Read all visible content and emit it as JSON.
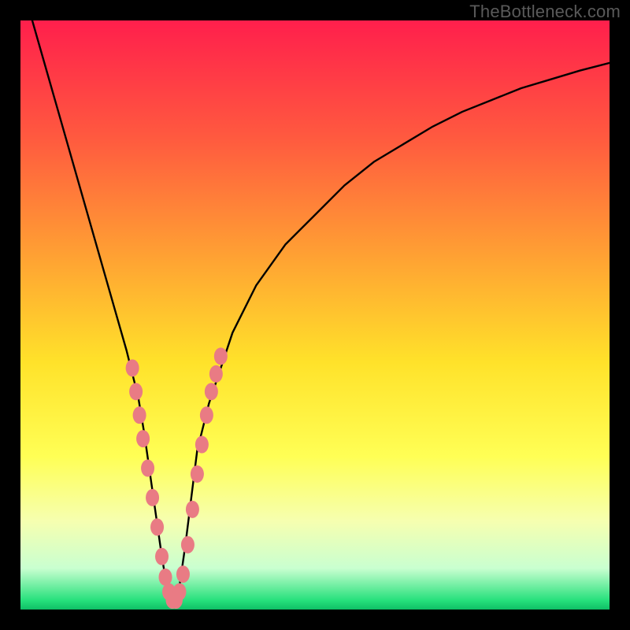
{
  "watermark": "TheBottleneck.com",
  "chart_data": {
    "type": "line",
    "title": "",
    "xlabel": "",
    "ylabel": "",
    "xlim": [
      0,
      100
    ],
    "ylim": [
      0,
      100
    ],
    "grid": false,
    "legend": false,
    "background_gradient_stops": [
      {
        "offset": 0.0,
        "color": "#ff1f4c"
      },
      {
        "offset": 0.2,
        "color": "#ff5a3f"
      },
      {
        "offset": 0.4,
        "color": "#ffa133"
      },
      {
        "offset": 0.58,
        "color": "#ffe22a"
      },
      {
        "offset": 0.74,
        "color": "#ffff55"
      },
      {
        "offset": 0.85,
        "color": "#f6ffb0"
      },
      {
        "offset": 0.93,
        "color": "#c9ffd0"
      },
      {
        "offset": 0.985,
        "color": "#25e07b"
      },
      {
        "offset": 1.0,
        "color": "#0fbf66"
      }
    ],
    "series": [
      {
        "name": "bottleneck-curve",
        "x": [
          2,
          4,
          6,
          8,
          10,
          12,
          14,
          16,
          18,
          20,
          21,
          22,
          23,
          24,
          25,
          26,
          27,
          28,
          29,
          30,
          32,
          34,
          36,
          40,
          45,
          50,
          55,
          60,
          65,
          70,
          75,
          80,
          85,
          90,
          95,
          100
        ],
        "y": [
          100,
          93,
          86,
          79,
          72,
          65,
          58,
          51,
          44,
          36,
          30,
          23,
          16,
          9,
          3,
          1,
          4,
          11,
          19,
          27,
          35,
          41,
          47,
          55,
          62,
          67,
          72,
          76,
          79,
          82,
          84.5,
          86.5,
          88.5,
          90,
          91.5,
          92.8
        ]
      }
    ],
    "markers": {
      "name": "highlight-beads",
      "color": "#e97b84",
      "points": [
        {
          "x": 19.0,
          "y": 41
        },
        {
          "x": 19.6,
          "y": 37
        },
        {
          "x": 20.2,
          "y": 33
        },
        {
          "x": 20.8,
          "y": 29
        },
        {
          "x": 21.6,
          "y": 24
        },
        {
          "x": 22.4,
          "y": 19
        },
        {
          "x": 23.2,
          "y": 14
        },
        {
          "x": 24.0,
          "y": 9
        },
        {
          "x": 24.6,
          "y": 5.5
        },
        {
          "x": 25.2,
          "y": 3
        },
        {
          "x": 25.8,
          "y": 1.6
        },
        {
          "x": 26.4,
          "y": 1.6
        },
        {
          "x": 27.0,
          "y": 3
        },
        {
          "x": 27.6,
          "y": 6
        },
        {
          "x": 28.4,
          "y": 11
        },
        {
          "x": 29.2,
          "y": 17
        },
        {
          "x": 30.0,
          "y": 23
        },
        {
          "x": 30.8,
          "y": 28
        },
        {
          "x": 31.6,
          "y": 33
        },
        {
          "x": 32.4,
          "y": 37
        },
        {
          "x": 33.2,
          "y": 40
        },
        {
          "x": 34.0,
          "y": 43
        }
      ]
    }
  }
}
